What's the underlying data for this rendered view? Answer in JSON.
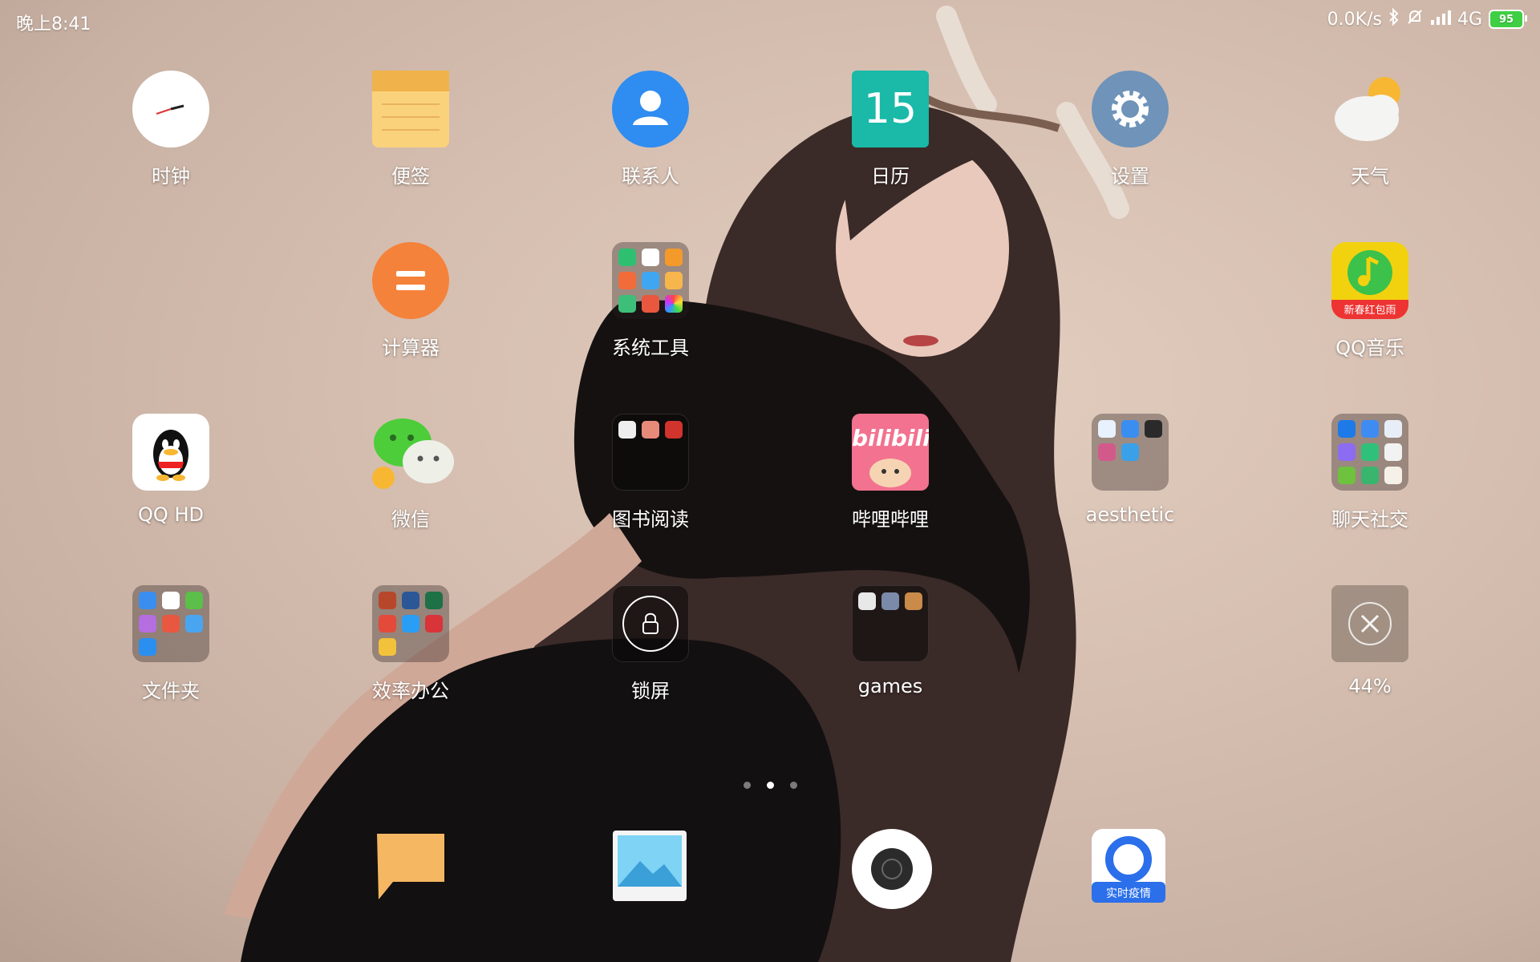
{
  "status_bar": {
    "time": "晚上8:41",
    "network_speed": "0.0K/s",
    "network_type": "4G",
    "battery": "95"
  },
  "home": {
    "apps": [
      {
        "id": "clock",
        "label": "时钟",
        "icon": "clock-icon"
      },
      {
        "id": "notes",
        "label": "便签",
        "icon": "notes-icon"
      },
      {
        "id": "contacts",
        "label": "联系人",
        "icon": "contacts-icon"
      },
      {
        "id": "calendar",
        "label": "日历",
        "icon": "calendar-icon",
        "badge": "15"
      },
      {
        "id": "settings",
        "label": "设置",
        "icon": "gear-icon"
      },
      {
        "id": "weather",
        "label": "天气",
        "icon": "weather-icon"
      },
      {
        "id": "calculator",
        "label": "计算器",
        "icon": "calculator-icon"
      },
      {
        "id": "system-tools",
        "label": "系统工具",
        "icon": "folder-icon"
      },
      {
        "id": "qq-music",
        "label": "QQ音乐",
        "icon": "qq-music-icon",
        "badge": "新春红包雨"
      },
      {
        "id": "qq-hd",
        "label": "QQ HD",
        "icon": "qq-icon"
      },
      {
        "id": "wechat",
        "label": "微信",
        "icon": "wechat-icon"
      },
      {
        "id": "books",
        "label": "图书阅读",
        "icon": "folder-icon"
      },
      {
        "id": "bilibili",
        "label": "哔哩哔哩",
        "icon": "bilibili-icon",
        "logo_text": "bilibili"
      },
      {
        "id": "aesthetic",
        "label": "aesthetic",
        "icon": "folder-icon"
      },
      {
        "id": "social",
        "label": "聊天社交",
        "icon": "folder-icon"
      },
      {
        "id": "files",
        "label": "文件夹",
        "icon": "folder-icon"
      },
      {
        "id": "office",
        "label": "效率办公",
        "icon": "folder-icon"
      },
      {
        "id": "lock",
        "label": "锁屏",
        "icon": "lock-icon"
      },
      {
        "id": "games",
        "label": "games",
        "icon": "folder-icon"
      },
      {
        "id": "cleaner",
        "label": "44%",
        "icon": "close-icon"
      }
    ]
  },
  "dock": [
    {
      "id": "messages",
      "icon": "message-icon"
    },
    {
      "id": "gallery",
      "icon": "gallery-icon"
    },
    {
      "id": "camera",
      "icon": "camera-icon"
    },
    {
      "id": "browser",
      "icon": "browser-icon",
      "badge": "实时疫情"
    }
  ],
  "pager": {
    "count": 3,
    "active": 1
  },
  "colors": {
    "contacts": "#2f8cf0",
    "calendar": "#1ab9a8",
    "settings": "#6f93b9",
    "calculator": "#f5823a",
    "battery": "#3fcf44",
    "qq_music": "#f2d20e",
    "bilibili": "#f2728f",
    "browser": "#2b6fea"
  }
}
